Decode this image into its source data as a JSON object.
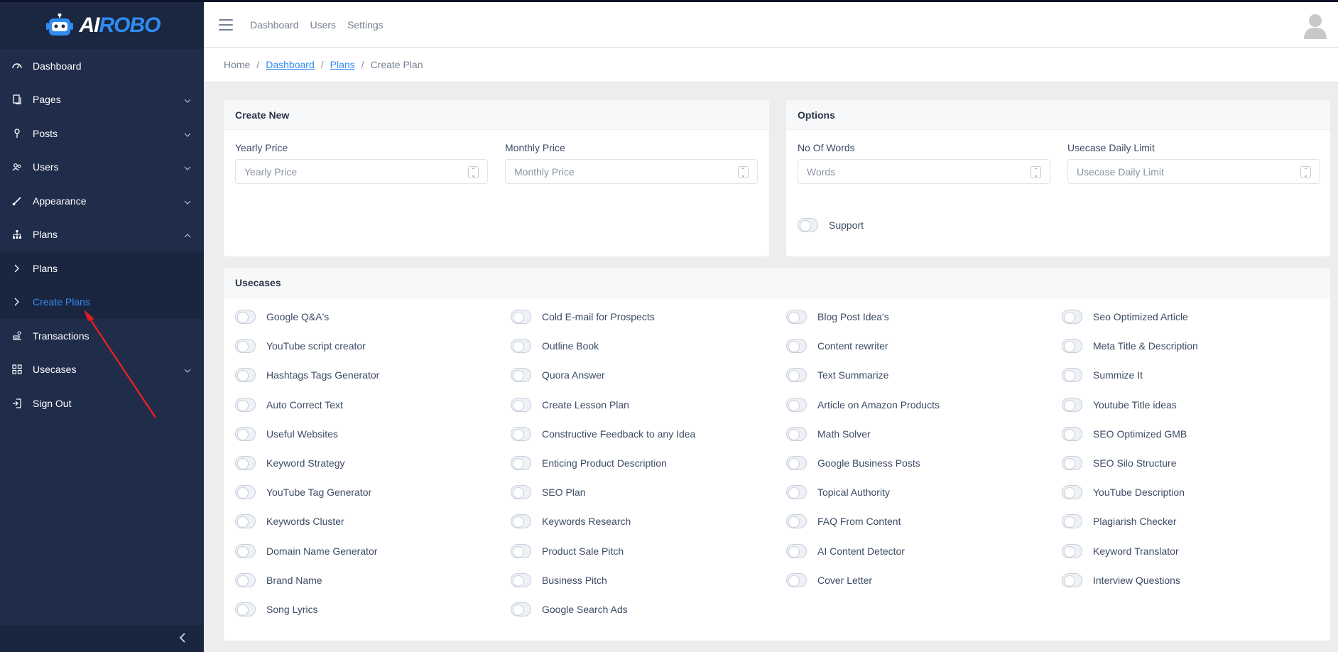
{
  "brand": {
    "name_ai": "AI",
    "name_rest": "ROBO"
  },
  "sidebar": {
    "items": [
      {
        "label": "Dashboard"
      },
      {
        "label": "Pages"
      },
      {
        "label": "Posts"
      },
      {
        "label": "Users"
      },
      {
        "label": "Appearance"
      },
      {
        "label": "Plans"
      },
      {
        "label": "Plans"
      },
      {
        "label": "Create Plans"
      },
      {
        "label": "Transactions"
      },
      {
        "label": "Usecases"
      },
      {
        "label": "Sign Out"
      }
    ],
    "active_color": "#2f8cf0"
  },
  "header": {
    "nav": [
      "Dashboard",
      "Users",
      "Settings"
    ]
  },
  "breadcrumb": {
    "home": "Home",
    "dashboard": "Dashboard",
    "plans": "Plans",
    "current": "Create Plan",
    "sep": "/"
  },
  "create_new": {
    "title": "Create New",
    "yearly_label": "Yearly Price",
    "yearly_placeholder": "Yearly Price",
    "monthly_label": "Monthly Price",
    "monthly_placeholder": "Monthly Price"
  },
  "options": {
    "title": "Options",
    "words_label": "No Of Words",
    "words_placeholder": "Words",
    "limit_label": "Usecase Daily Limit",
    "limit_placeholder": "Usecase Daily Limit",
    "support_label": "Support"
  },
  "usecases": {
    "title": "Usecases",
    "items": [
      "Google Q&A's",
      "Cold E-mail for Prospects",
      "Blog Post Idea's",
      "Seo Optimized Article",
      "YouTube script creator",
      "Outline Book",
      "Content rewriter",
      "Meta Title & Description",
      "Hashtags Tags Generator",
      "Quora Answer",
      "Text Summarize",
      "Summize It",
      "Auto Correct Text",
      "Create Lesson Plan",
      "Article on Amazon Products",
      "Youtube Title ideas",
      "Useful Websites",
      "Constructive Feedback to any Idea",
      "Math Solver",
      "SEO Optimized GMB",
      "Keyword Strategy",
      "Enticing Product Description",
      "Google Business Posts",
      "SEO Silo Structure",
      "YouTube Tag Generator",
      "SEO Plan",
      "Topical Authority",
      "YouTube Description",
      "Keywords Cluster",
      "Keywords Research",
      "FAQ From Content",
      "Plagiarish Checker",
      "Domain Name Generator",
      "Product Sale Pitch",
      "AI Content Detector",
      "Keyword Translator",
      "Brand Name",
      "Business Pitch",
      "Cover Letter",
      "Interview Questions",
      "Song Lyrics",
      "Google Search Ads"
    ]
  },
  "colors": {
    "sidebar": "#1f2c4a",
    "accent": "#2f8cf0",
    "annotation_arrow": "#e02020"
  }
}
